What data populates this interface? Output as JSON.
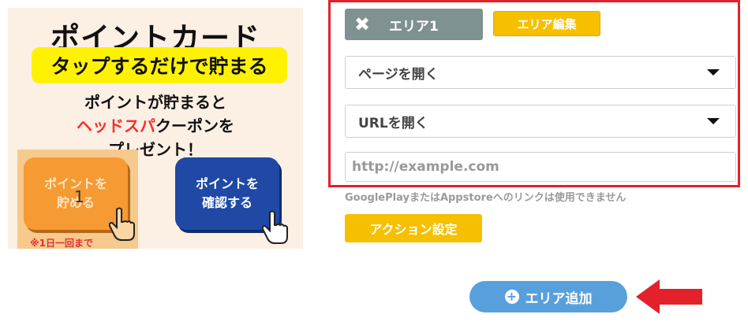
{
  "card": {
    "title": "ポイントカード",
    "banner": "タップするだけで貯まる",
    "line1": "ポイントが貯まると",
    "line2_red": "ヘッドスパ",
    "line2_rest": "クーポンを",
    "line3": "プレゼント！",
    "tile_left_1": "ポイントを",
    "tile_left_2": "貯める",
    "tile_left_number": "1",
    "tile_right_1": "ポイントを",
    "tile_right_2": "確認する",
    "note": "※1日一回まで"
  },
  "area": {
    "tab_label": "エリア1",
    "edit_label": "エリア編集",
    "select_page": "ページを開く",
    "select_url": "URLを開く",
    "url_placeholder": "http://example.com",
    "hint": "GooglePlayまたはAppstoreへのリンクは使用できません",
    "action_label": "アクション設定",
    "add_label": "エリア追加"
  },
  "colors": {
    "accent_yellow": "#f6c000",
    "tab_gray": "#7f9191",
    "add_blue": "#58a0dc",
    "highlight_red": "#e3212b"
  },
  "icons": {
    "close": "close-icon",
    "caret": "caret-down-icon",
    "plus": "plus-circle-icon",
    "arrow": "arrow-left-icon"
  }
}
